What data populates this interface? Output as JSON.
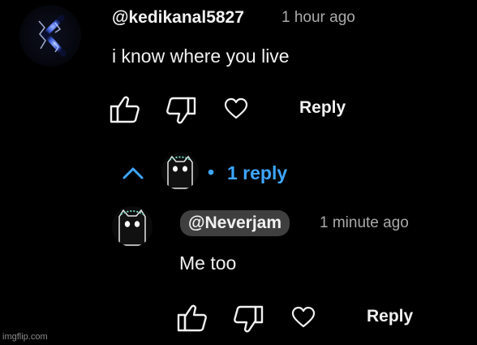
{
  "comment": {
    "author": "@kedikanal5827",
    "time": "1 hour ago",
    "text": "i know where you live",
    "reply_label": "Reply"
  },
  "replies_toggle": {
    "label": "1 reply",
    "bullet": "•"
  },
  "reply": {
    "author": "@Neverjam",
    "time": "1 minute ago",
    "text": "Me too",
    "reply_label": "Reply"
  },
  "watermark": "imgflip.com",
  "colors": {
    "background": "#000000",
    "link_blue": "#3ea6ff",
    "pill_bg": "#3f3f3f",
    "muted_text": "#aaaaaa"
  },
  "icons": {
    "like": "thumbs-up-icon",
    "dislike": "thumbs-down-icon",
    "heart": "heart-icon",
    "collapse": "chevron-up-icon"
  }
}
